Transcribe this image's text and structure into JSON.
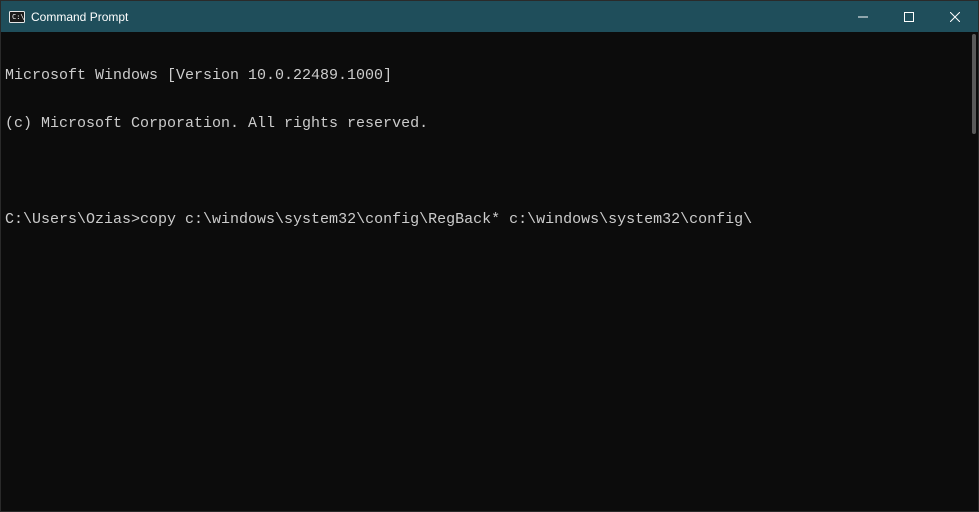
{
  "titlebar": {
    "title": "Command Prompt"
  },
  "terminal": {
    "line1": "Microsoft Windows [Version 10.0.22489.1000]",
    "line2": "(c) Microsoft Corporation. All rights reserved.",
    "prompt": "C:\\Users\\Ozias>",
    "command": "copy c:\\windows\\system32\\config\\RegBack* c:\\windows\\system32\\config\\"
  }
}
